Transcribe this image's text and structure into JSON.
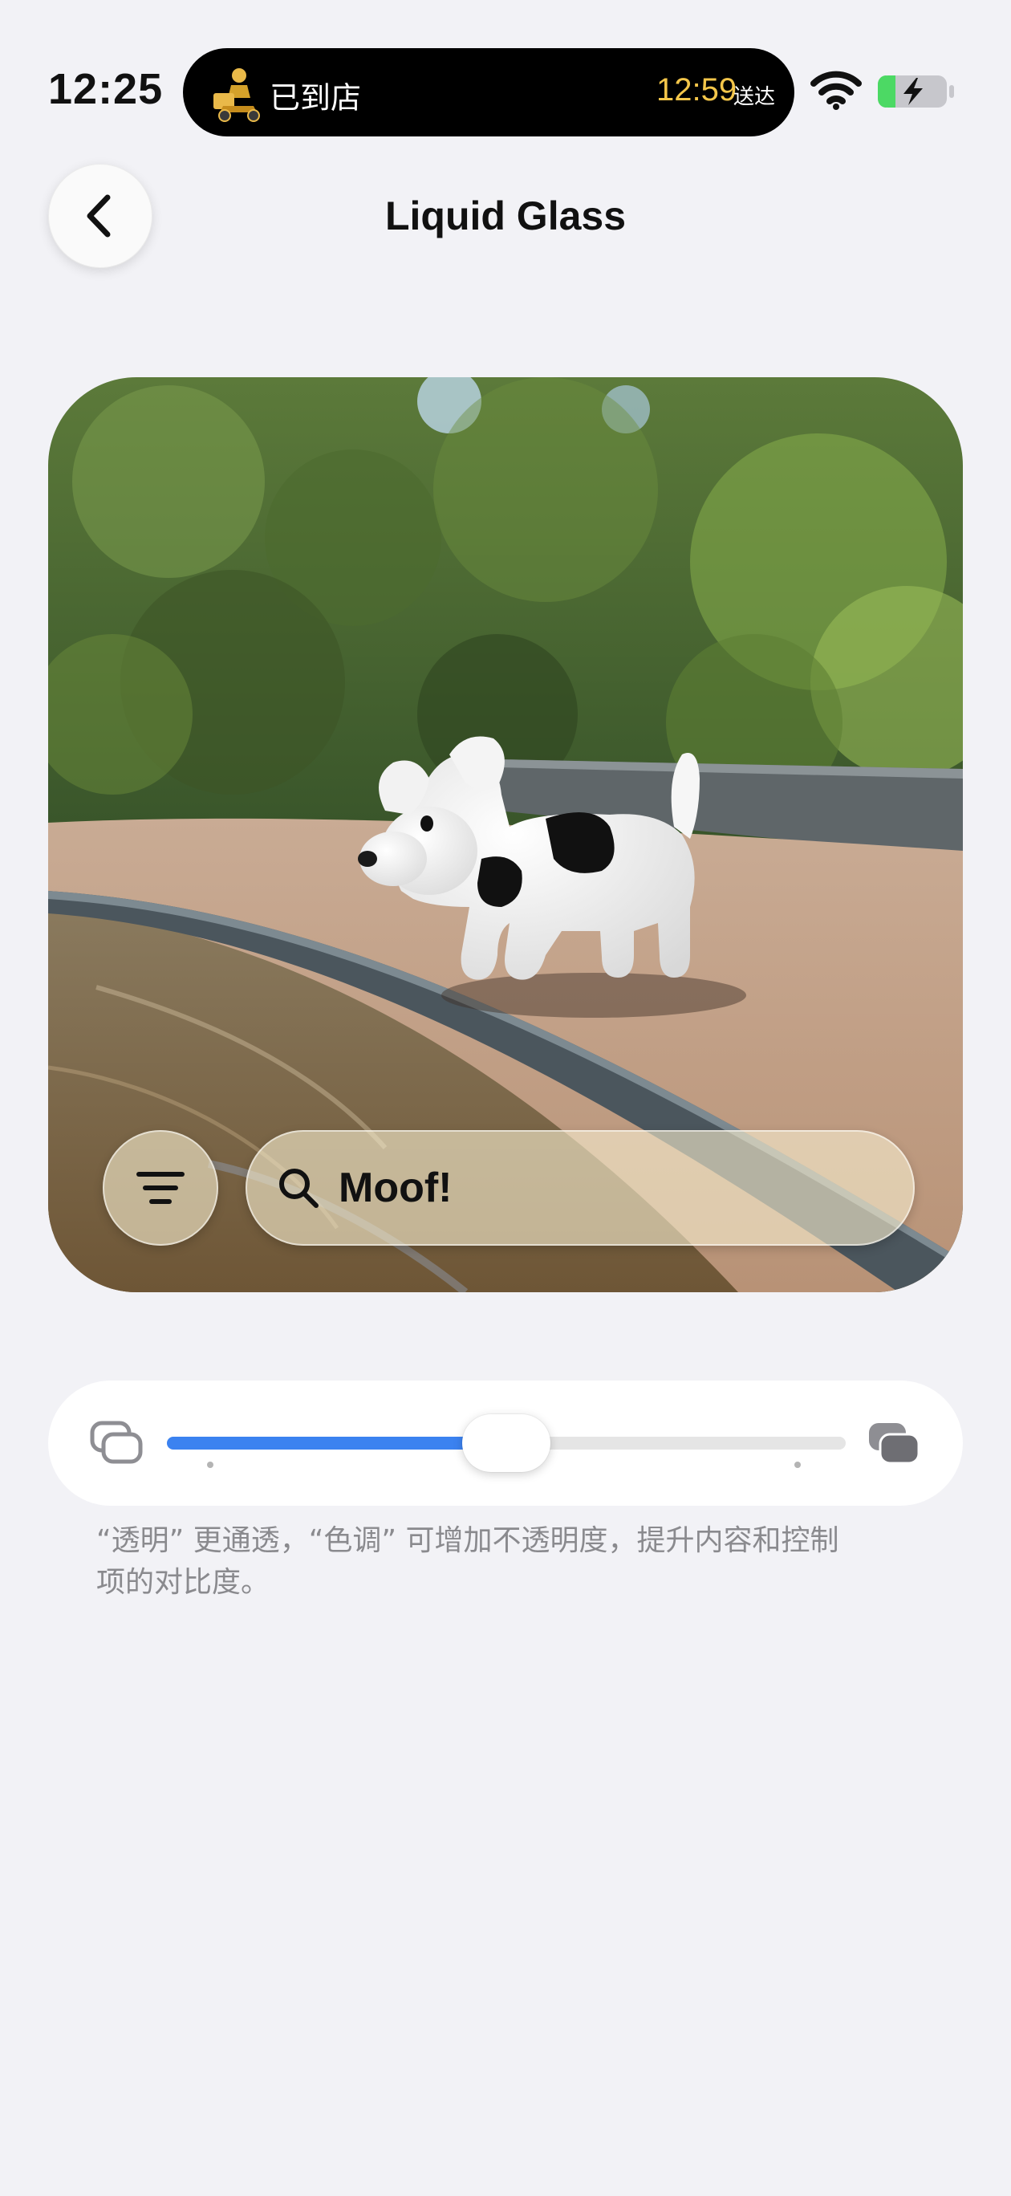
{
  "status_bar": {
    "time": "12:25",
    "live_activity": {
      "label": "已到店",
      "eta_time": "12:59",
      "eta_suffix": "送达"
    },
    "battery_icon": "battery-charging-icon",
    "wifi_icon": "wifi-icon"
  },
  "nav": {
    "back_icon": "chevron-left-icon",
    "title": "Liquid Glass"
  },
  "preview": {
    "menu_icon": "filter-lines-icon",
    "search_icon": "search-icon",
    "search_text": "Moof!"
  },
  "appearance_slider": {
    "left_icon": "clear-glass-icon",
    "right_icon": "tinted-glass-icon",
    "value_fraction": 0.5,
    "accent_color": "#3b82f0"
  },
  "caption": "“透明” 更通透，“色调” 可增加不透明度，提升内容和控制项的对比度。"
}
